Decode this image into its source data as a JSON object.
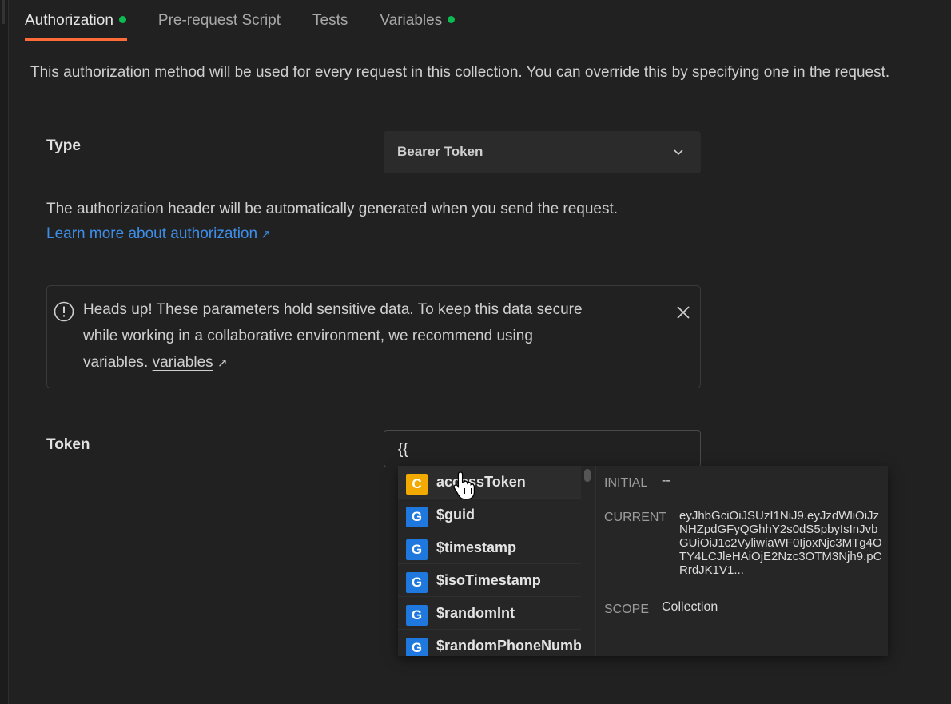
{
  "tabs": [
    {
      "label": "Authorization",
      "active": true,
      "dot": true
    },
    {
      "label": "Pre-request Script",
      "active": false,
      "dot": false
    },
    {
      "label": "Tests",
      "active": false,
      "dot": false
    },
    {
      "label": "Variables",
      "active": false,
      "dot": true
    }
  ],
  "intro": "This authorization method will be used for every request in this collection. You can override this by specifying one in the request.",
  "type": {
    "label": "Type",
    "value": "Bearer Token"
  },
  "description": {
    "text": "The authorization header will be automatically generated when you send the request.",
    "link": "Learn more about authorization"
  },
  "alert": {
    "line1": "Heads up! These parameters hold sensitive data. To keep this data secure",
    "line2": "while working in a collaborative environment, we recommend using",
    "line3_prefix": "variables.",
    "line3_link": "variables"
  },
  "token": {
    "label": "Token",
    "value": "{{"
  },
  "autocomplete": {
    "items": [
      {
        "badge": "C",
        "name": "accessToken"
      },
      {
        "badge": "G",
        "name": "$guid"
      },
      {
        "badge": "G",
        "name": "$timestamp"
      },
      {
        "badge": "G",
        "name": "$isoTimestamp"
      },
      {
        "badge": "G",
        "name": "$randomInt"
      },
      {
        "badge": "G",
        "name": "$randomPhoneNumb"
      }
    ],
    "detail": {
      "initial_label": "INITIAL",
      "initial_value": "--",
      "current_label": "CURRENT",
      "current_value": "eyJhbGciOiJSUzI1NiJ9.eyJzdWliOiJzNHZpdGFyQGhhY2s0dS5pbyIsInJvbGUiOiJ1c2VyliwiaWF0IjoxNjc3MTg4OTY4LCJleHAiOjE2Nzc3OTM3Njh9.pCRrdJK1V1...",
      "scope_label": "SCOPE",
      "scope_value": "Collection"
    }
  },
  "colors": {
    "accent": "#ff6c37",
    "dot": "#0cbb52",
    "link": "#3d8ee8",
    "badge_collection": "#f2a900",
    "badge_global": "#1e78de"
  }
}
